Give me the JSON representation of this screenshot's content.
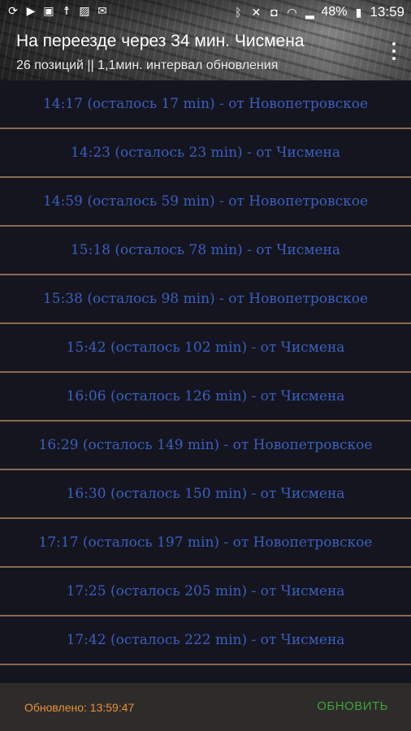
{
  "status_bar": {
    "battery_percent": "48%",
    "time": "13:59",
    "left_icons": [
      "sync-icon",
      "play-store-icon",
      "screenshot-icon",
      "notification-icon",
      "image-icon",
      "mail-icon"
    ],
    "right_icons": [
      "bluetooth-icon",
      "mute-icon",
      "nfc-icon",
      "wifi-icon",
      "signal-icon",
      "battery-icon"
    ]
  },
  "header": {
    "title": "На переезде через 34 мин. Чисмена",
    "subtitle": "26 позиций || 1,1мин. интервал обновления"
  },
  "schedule": {
    "items": [
      {
        "text": "14:17 (осталось 17 min) - от Новопетровское"
      },
      {
        "text": "14:23 (осталось 23 min) - от Чисмена"
      },
      {
        "text": "14:59 (осталось 59 min) - от Новопетровское"
      },
      {
        "text": "15:18 (осталось 78 min) - от Чисмена"
      },
      {
        "text": "15:38 (осталось 98 min) - от Новопетровское"
      },
      {
        "text": "15:42 (осталось 102 min) - от Чисмена"
      },
      {
        "text": "16:06 (осталось 126 min) - от Чисмена"
      },
      {
        "text": "16:29 (осталось 149 min) - от Новопетровское"
      },
      {
        "text": "16:30 (осталось 150 min) - от Чисмена"
      },
      {
        "text": "17:17 (осталось 197 min) - от Новопетровское"
      },
      {
        "text": "17:25 (осталось 205 min) - от Чисмена"
      },
      {
        "text": "17:42 (осталось 222 min) - от Чисмена"
      },
      {
        "text": ""
      }
    ]
  },
  "footer": {
    "updated_label": "Обновлено: 13:59:47",
    "refresh_button": "ОБНОВИТЬ"
  },
  "colors": {
    "row_text": "#3a5fc0",
    "row_divider": "#8a6a50",
    "updated_text": "#e8913a",
    "refresh_text": "#3fa13a"
  }
}
